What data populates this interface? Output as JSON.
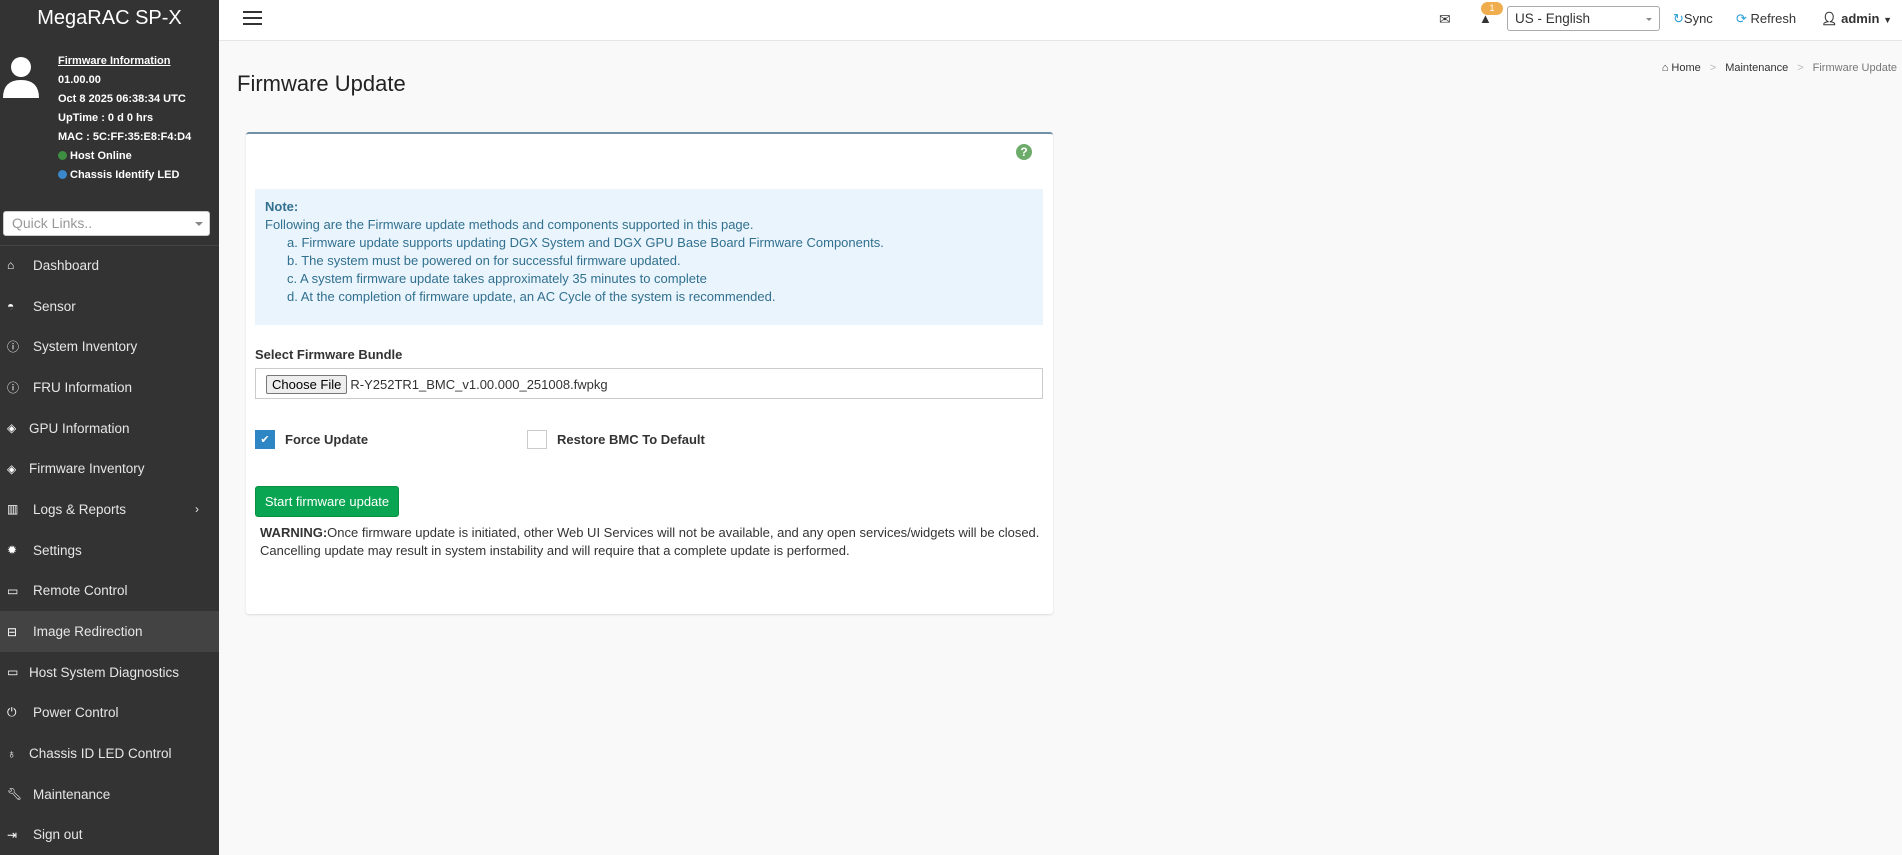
{
  "sidebar": {
    "brand": "MegaRAC SP-X",
    "fw_link": "Firmware Information",
    "fw_version": "01.00.00",
    "datetime": "Oct 8 2025 06:38:34 UTC",
    "uptime": "UpTime : 0 d 0 hrs",
    "mac": "MAC : 5C:FF:35:E8:F4:D4",
    "host_status": "Host Online",
    "chassis_led": "Chassis Identify LED",
    "quick_links_placeholder": "Quick Links..",
    "items": [
      {
        "label": "Dashboard",
        "icon": "home-icon"
      },
      {
        "label": "Sensor",
        "icon": "gauge-icon"
      },
      {
        "label": "System Inventory",
        "icon": "info-icon"
      },
      {
        "label": "FRU Information",
        "icon": "info-icon"
      },
      {
        "label": "GPU Information",
        "icon": "cube-icon"
      },
      {
        "label": "Firmware Inventory",
        "icon": "cube-icon"
      },
      {
        "label": "Logs & Reports",
        "icon": "bar-chart-icon"
      },
      {
        "label": "Settings",
        "icon": "gear-icon"
      },
      {
        "label": "Remote Control",
        "icon": "monitor-icon"
      },
      {
        "label": "Image Redirection",
        "icon": "drive-icon"
      },
      {
        "label": "Host System Diagnostics",
        "icon": "monitor-icon"
      },
      {
        "label": "Power Control",
        "icon": "power-icon"
      },
      {
        "label": "Chassis ID LED Control",
        "icon": "lightbulb-icon"
      },
      {
        "label": "Maintenance",
        "icon": "wrench-icon"
      },
      {
        "label": "Sign out",
        "icon": "sign-out-icon"
      }
    ]
  },
  "topbar": {
    "alert_count": "1",
    "language": "US - English",
    "sync": "Sync",
    "refresh": "Refresh",
    "user": "admin"
  },
  "breadcrumb": {
    "home": "Home",
    "section": "Maintenance",
    "current": "Firmware Update"
  },
  "page": {
    "title": "Firmware Update",
    "note_title": "Note:",
    "note_intro": "Following are the Firmware update methods and components supported in this page.",
    "note_items": [
      "a. Firmware update supports updating DGX System and DGX GPU Base Board Firmware Components.",
      "b. The system must be powered on for successful firmware updated.",
      "c. A system firmware update takes approximately 35 minutes to complete",
      "d. At the completion of firmware update, an AC Cycle of the system is recommended."
    ],
    "bundle_label": "Select Firmware Bundle",
    "choose_file": "Choose File",
    "file_name": "R-Y252TR1_BMC_v1.00.000_251008.fwpkg",
    "force_update": "Force Update",
    "force_update_checked": true,
    "restore_default": "Restore BMC To Default",
    "restore_default_checked": false,
    "start_button": "Start firmware update",
    "warning_label": "WARNING:",
    "warning_text1": "Once firmware update is initiated, other Web UI Services will not be available, and any open services/widgets will be closed.",
    "warning_text2": "Cancelling update may result in system instability and will require that a complete update is performed."
  },
  "colors": {
    "sidebar": "#333333",
    "accent": "#2a9fd6",
    "success": "#0aa552",
    "note_bg": "#eaf4fc"
  }
}
